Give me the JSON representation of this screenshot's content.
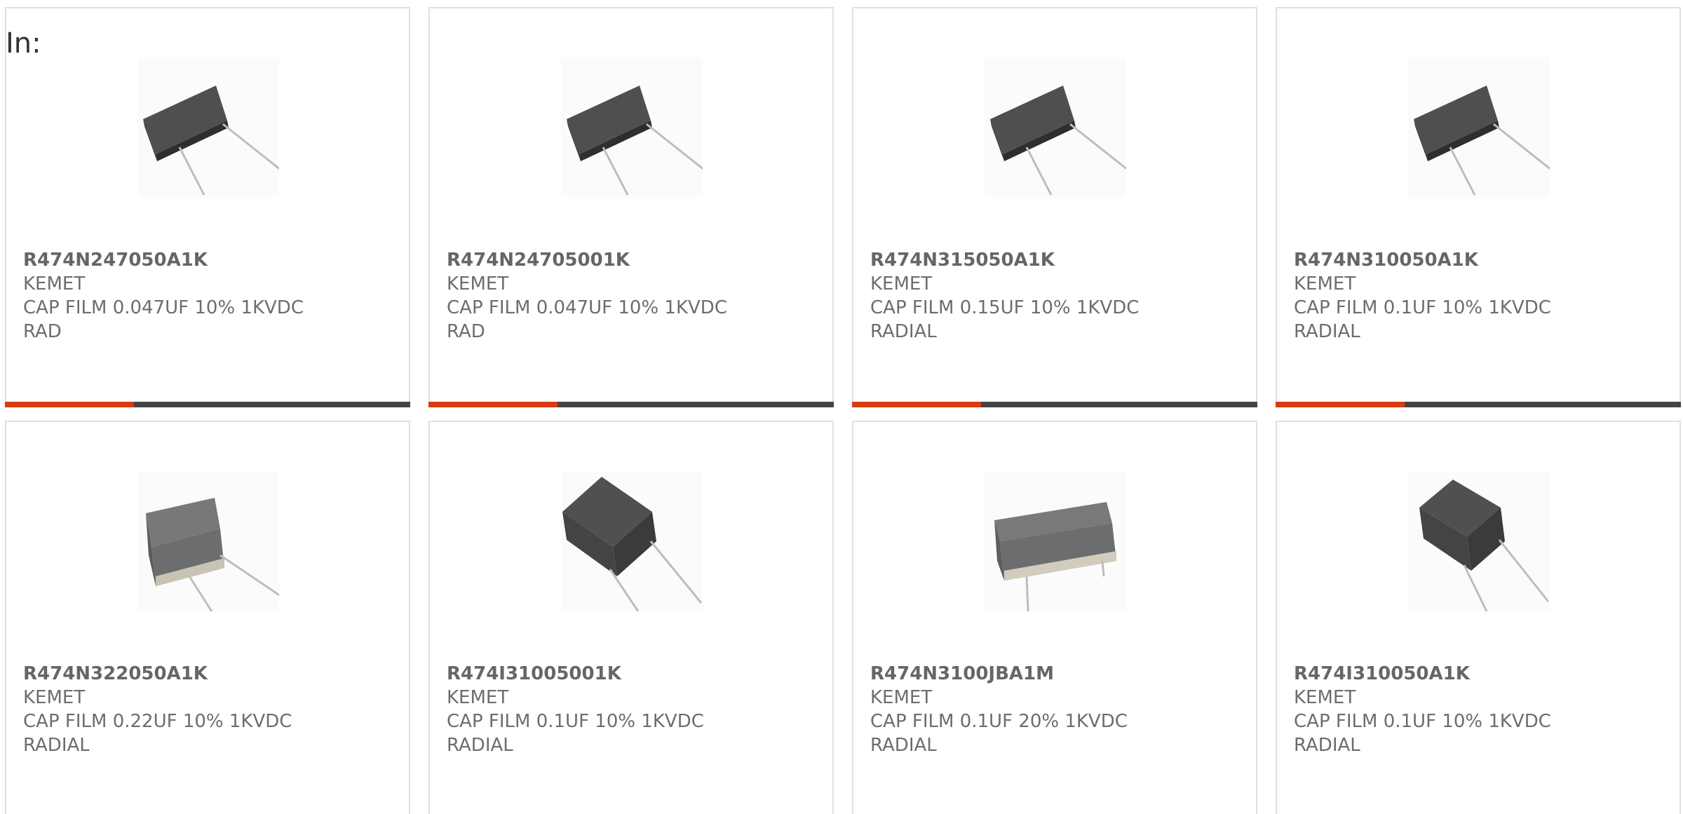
{
  "filter_label": "In:",
  "colors": {
    "accent": "#d83b10",
    "bar": "#444444",
    "border": "#e0e0e0"
  },
  "products": [
    {
      "part_number": "R474N247050A1K",
      "manufacturer": "KEMET",
      "desc_line1": "CAP FILM 0.047UF 10% 1KVDC",
      "desc_line2": "RAD",
      "image": "wide-radial-film-capacitor"
    },
    {
      "part_number": "R474N24705001K",
      "manufacturer": "KEMET",
      "desc_line1": "CAP FILM 0.047UF 10% 1KVDC",
      "desc_line2": "RAD",
      "image": "wide-radial-film-capacitor"
    },
    {
      "part_number": "R474N315050A1K",
      "manufacturer": "KEMET",
      "desc_line1": "CAP FILM 0.15UF 10% 1KVDC",
      "desc_line2": "RADIAL",
      "image": "wide-radial-film-capacitor"
    },
    {
      "part_number": "R474N310050A1K",
      "manufacturer": "KEMET",
      "desc_line1": "CAP FILM 0.1UF 10% 1KVDC",
      "desc_line2": "RADIAL",
      "image": "wide-radial-film-capacitor"
    },
    {
      "part_number": "R474N322050A1K",
      "manufacturer": "KEMET",
      "desc_line1": "CAP FILM 0.22UF 10% 1KVDC",
      "desc_line2": "RADIAL",
      "image": "boxy-film-capacitor"
    },
    {
      "part_number": "R474I31005001K",
      "manufacturer": "KEMET",
      "desc_line1": "CAP FILM 0.1UF 10% 1KVDC",
      "desc_line2": "RADIAL",
      "image": "small-dark-film-capacitor"
    },
    {
      "part_number": "R474N3100JBA1M",
      "manufacturer": "KEMET",
      "desc_line1": "CAP FILM 0.1UF 20% 1KVDC",
      "desc_line2": "RADIAL",
      "image": "flat-film-capacitor"
    },
    {
      "part_number": "R474I310050A1K",
      "manufacturer": "KEMET",
      "desc_line1": "CAP FILM 0.1UF 10% 1KVDC",
      "desc_line2": "RADIAL",
      "image": "small-dark-film-capacitor"
    }
  ]
}
